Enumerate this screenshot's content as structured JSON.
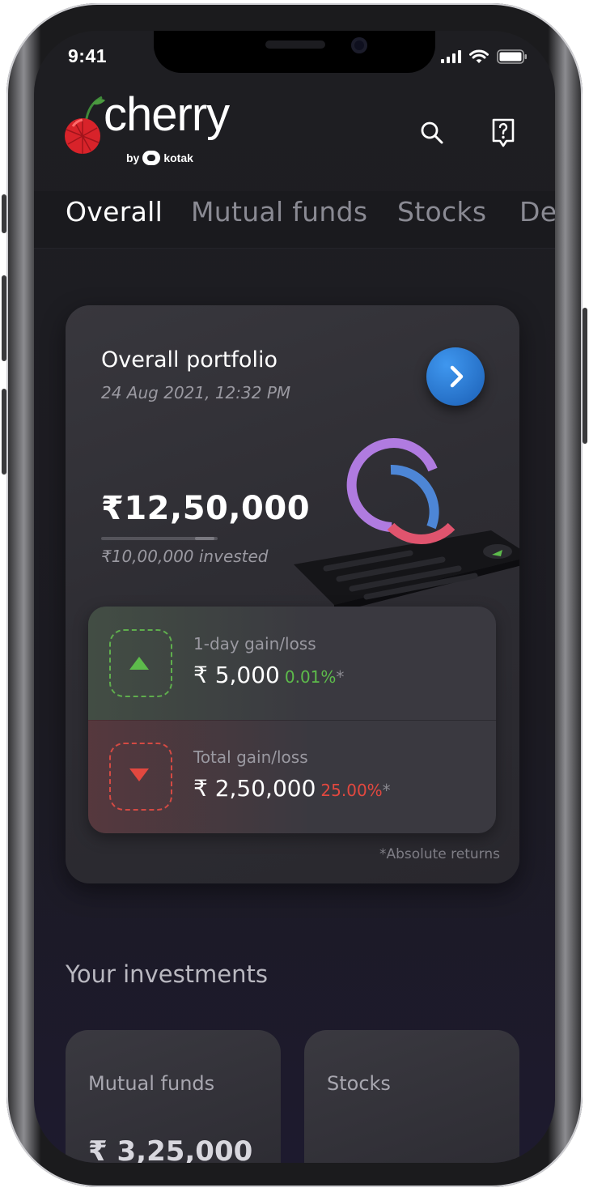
{
  "status_bar": {
    "time": "9:41"
  },
  "brand": {
    "logo_text": "cherry",
    "by_text": "by",
    "partner": "kotak"
  },
  "header_icons": [
    "search-icon",
    "help-icon"
  ],
  "tabs": [
    {
      "label": "Overall",
      "active": true
    },
    {
      "label": "Mutual funds",
      "active": false
    },
    {
      "label": "Stocks",
      "active": false
    },
    {
      "label": "De",
      "active": false
    }
  ],
  "portfolio": {
    "title": "Overall portfolio",
    "date": "24 Aug 2021, 12:32 PM",
    "amount": "₹12,50,000",
    "invested": "₹10,00,000 invested"
  },
  "gains": [
    {
      "label": "1-day gain/loss",
      "value": "₹ 5,000",
      "percent": "0.01%",
      "asterisk": "*",
      "direction": "up"
    },
    {
      "label": "Total gain/loss",
      "value": "₹ 2,50,000",
      "percent": "25.00%",
      "asterisk": "*",
      "direction": "down"
    }
  ],
  "footnote": "*Absolute returns",
  "investments": {
    "section_title": "Your investments",
    "cards": [
      {
        "label": "Mutual funds",
        "value": "₹ 3,25,000"
      },
      {
        "label": "Stocks",
        "value": ""
      }
    ]
  },
  "colors": {
    "background": "#1e1e22",
    "accent_blue": "#2a7ad6",
    "gain_green": "#5dbb4b",
    "loss_red": "#e2483f",
    "ring_purple": "#b07be0",
    "ring_blue": "#4d86d6",
    "ring_pink": "#e0546e"
  }
}
